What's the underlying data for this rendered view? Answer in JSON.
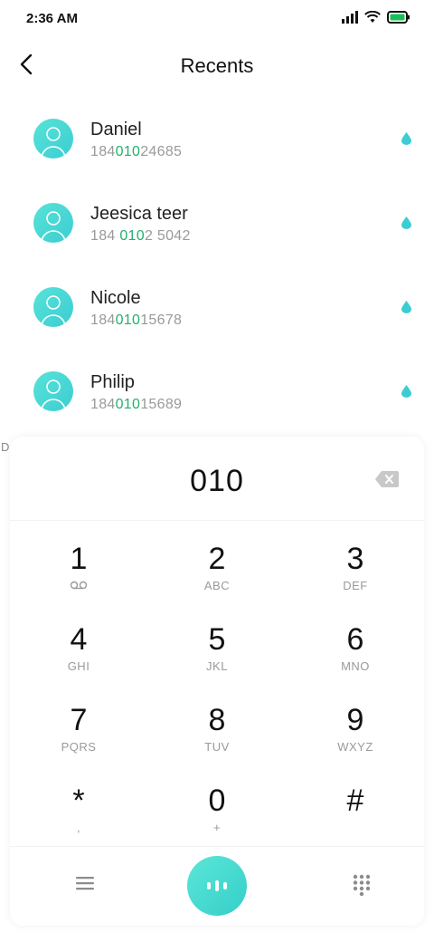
{
  "status_bar": {
    "time": "2:36 AM"
  },
  "header": {
    "title": "Recents"
  },
  "contacts": [
    {
      "name": "Daniel",
      "number_prefix": "184",
      "number_match": "010",
      "number_suffix": "24685"
    },
    {
      "name": "Jeesica teer",
      "number_prefix": "184 ",
      "number_match": "010",
      "number_suffix": "2 5042"
    },
    {
      "name": "Nicole",
      "number_prefix": "184",
      "number_match": "010",
      "number_suffix": "15678"
    },
    {
      "name": "Philip",
      "number_prefix": "184",
      "number_match": "010",
      "number_suffix": "15689"
    }
  ],
  "edge_letter": "D",
  "dialer": {
    "entered_number": "010",
    "keys": [
      {
        "digit": "1",
        "letters": ""
      },
      {
        "digit": "2",
        "letters": "ABC"
      },
      {
        "digit": "3",
        "letters": "DEF"
      },
      {
        "digit": "4",
        "letters": "GHI"
      },
      {
        "digit": "5",
        "letters": "JKL"
      },
      {
        "digit": "6",
        "letters": "MNO"
      },
      {
        "digit": "7",
        "letters": "PQRS"
      },
      {
        "digit": "8",
        "letters": "TUV"
      },
      {
        "digit": "9",
        "letters": "WXYZ"
      },
      {
        "digit": "*",
        "letters": ","
      },
      {
        "digit": "0",
        "letters": "+"
      },
      {
        "digit": "#",
        "letters": ""
      }
    ]
  },
  "icons": {
    "back": "chevron-left-icon",
    "voicemail": "voicemail-icon",
    "backspace": "backspace-icon",
    "menu": "menu-icon",
    "call": "call-icon",
    "dialpad": "dialpad-icon"
  },
  "colors": {
    "accent": "#3ccdd2",
    "match_highlight": "#1fb26c"
  }
}
